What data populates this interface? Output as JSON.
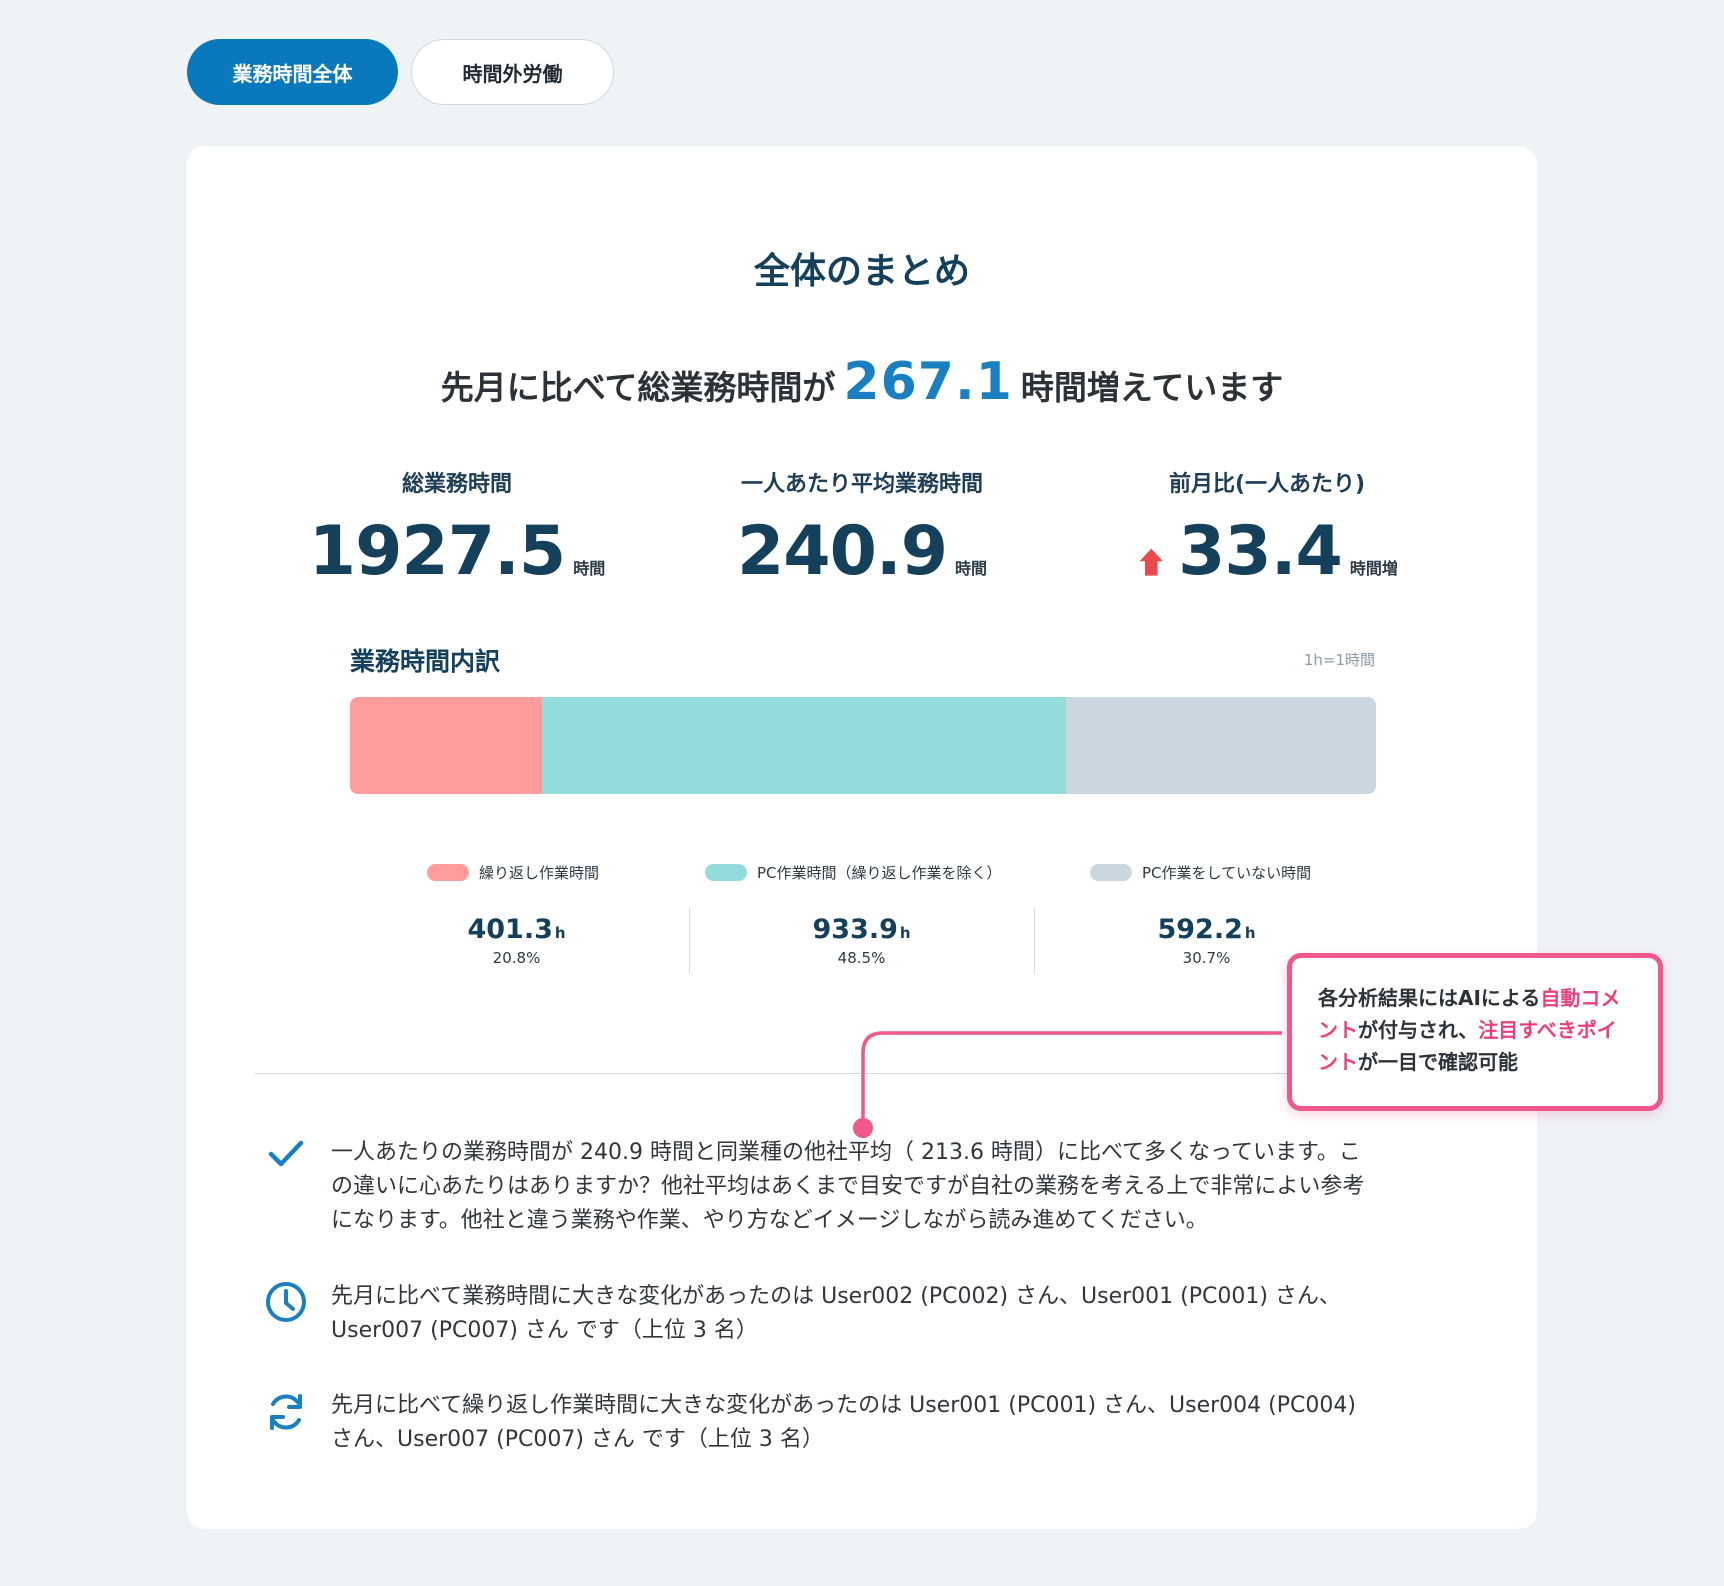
{
  "tabs": {
    "active_label": "業務時間全体",
    "inactive_label": "時間外労働"
  },
  "summary": {
    "title": "全体のまとめ",
    "headline_prefix": "先月に比べて総業務時間が",
    "headline_value": "267.1",
    "headline_suffix": "時間増えています"
  },
  "stats": [
    {
      "label": "総業務時間",
      "value": "1927.5",
      "unit": "時間"
    },
    {
      "label": "一人あたり平均業務時間",
      "value": "240.9",
      "unit": "時間"
    },
    {
      "label": "前月比(一人あたり)",
      "value": "33.4",
      "unit": "時間増",
      "trend_icon": "arrow-up-icon"
    }
  ],
  "breakdown": {
    "title": "業務時間内訳",
    "note": "1h=1時間",
    "segments": [
      {
        "label": "繰り返し作業時間",
        "value": "401.3",
        "unit": "h",
        "percent": "20.8%",
        "fraction": 0.187,
        "color": "#ff9c9c"
      },
      {
        "label": "PC作業時間（繰り返し作業を除く）",
        "value": "933.9",
        "unit": "h",
        "percent": "48.5%",
        "fraction": 0.511,
        "color": "#92dcdc"
      },
      {
        "label": "PC作業をしていない時間",
        "value": "592.2",
        "unit": "h",
        "percent": "30.7%",
        "fraction": 0.302,
        "color": "#cbd7e0"
      }
    ]
  },
  "comments": [
    {
      "icon": "check-icon",
      "text": "一人あたりの業務時間が 240.9 時間と同業種の他社平均（ 213.6 時間）に比べて多くなっています。この違いに心あたりはありますか？他社平均はあくまで目安ですが自社の業務を考える上で非常によい参考になります。他社と違う業務や作業、やり方などイメージしながら読み進めてください。"
    },
    {
      "icon": "clock-icon",
      "text": "先月に比べて業務時間に大きな変化があったのは User002 (PC002) さん、User001 (PC001) さん、User007 (PC007) さん です（上位 3 名）"
    },
    {
      "icon": "refresh-icon",
      "text": "先月に比べて繰り返し作業時間に大きな変化があったのは User001 (PC001) さん、User004 (PC004) さん、User007 (PC007) さん です（上位 3 名）"
    }
  ],
  "callout": {
    "part1": "各分析結果にはAIによる",
    "part2": "自動コメント",
    "part3": "が付与され、",
    "part4": "注目すべきポイント",
    "part5": "が一目で確認可能"
  },
  "colors": {
    "accent": "#0a78bd",
    "heading": "#14405c",
    "increase": "#e84b4b",
    "callout": "#f0578b"
  }
}
